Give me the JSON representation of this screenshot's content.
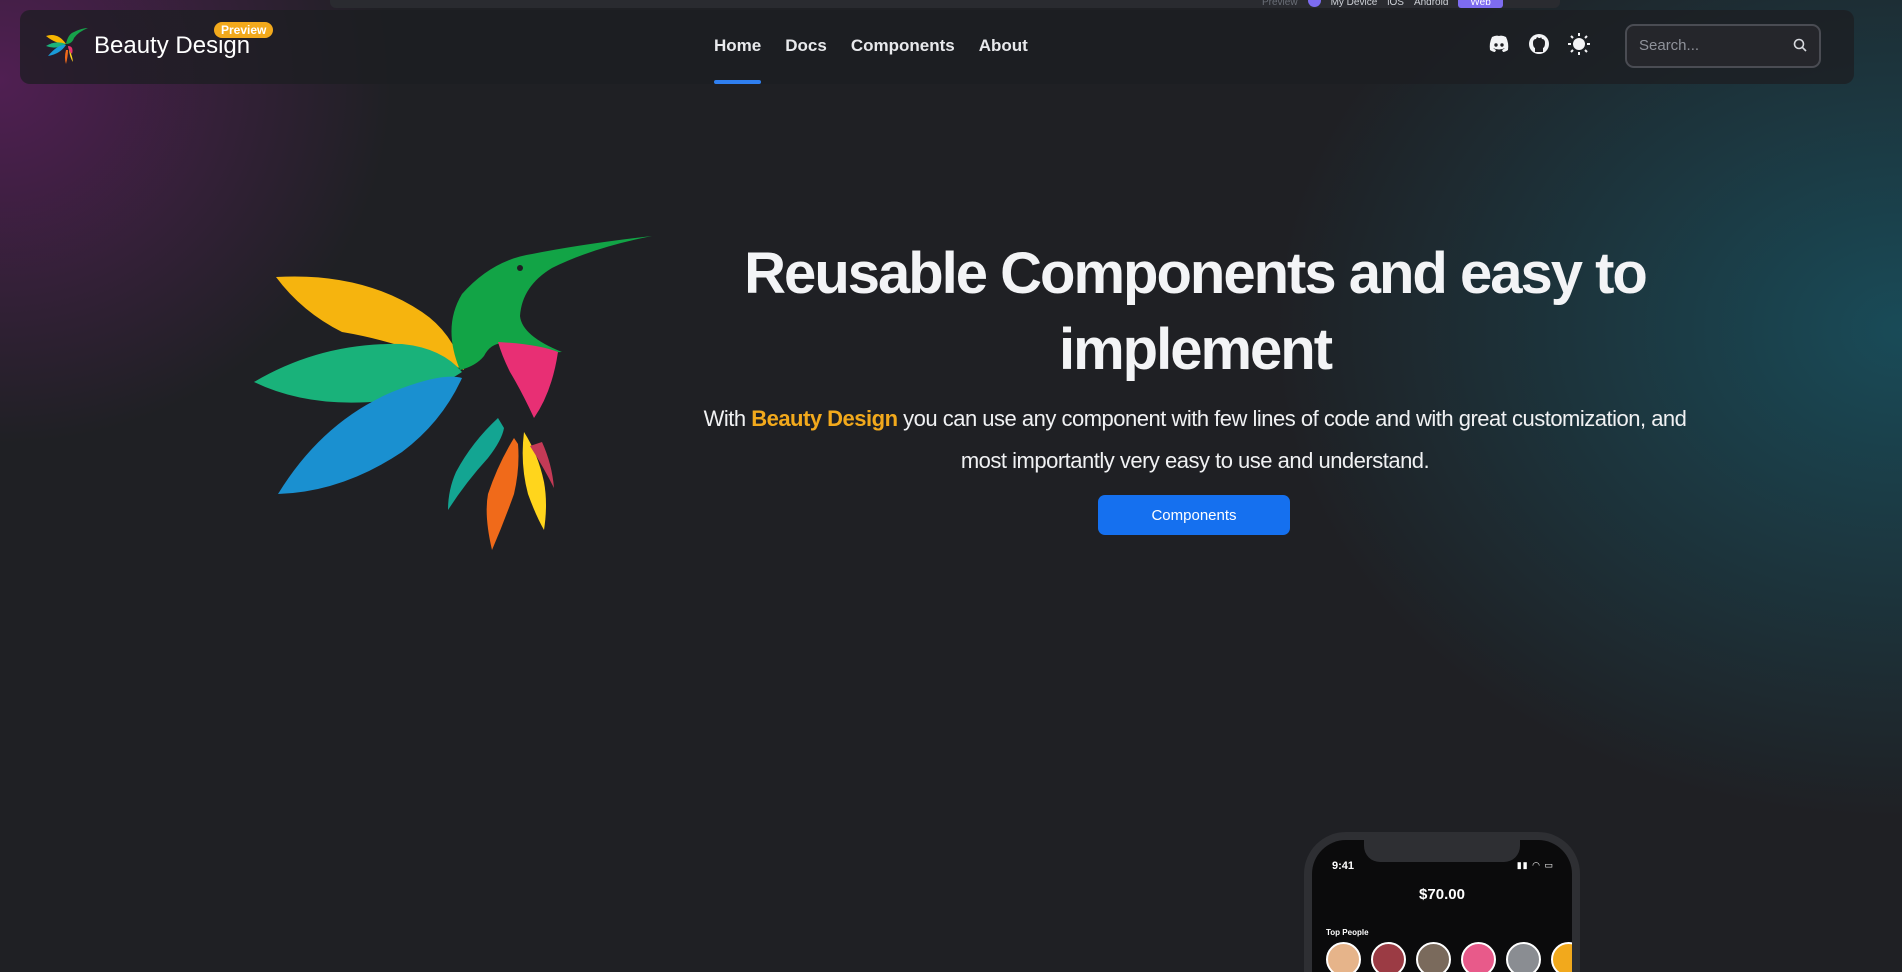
{
  "device_bar": {
    "preview_label": "Preview",
    "options": [
      "My Device",
      "iOS",
      "Android",
      "Web"
    ],
    "selected": "Web"
  },
  "header": {
    "brand": "Beauty Design",
    "badge": "Preview",
    "nav": [
      {
        "label": "Home",
        "active": true
      },
      {
        "label": "Docs",
        "active": false
      },
      {
        "label": "Components",
        "active": false
      },
      {
        "label": "About",
        "active": false
      }
    ],
    "icons": [
      "discord-icon",
      "github-icon",
      "theme-toggle-icon"
    ],
    "search_placeholder": "Search..."
  },
  "hero": {
    "title": "Reusable Components and easy to implement",
    "subtitle_prefix": "With ",
    "subtitle_brand": "Beauty Design",
    "subtitle_rest": " you can use any component with few lines of code and with great customization, and most importantly very easy to use and understand.",
    "cta": "Components"
  },
  "phone": {
    "time": "9:41",
    "amount": "$70.00",
    "section": "Top People"
  },
  "colors": {
    "accent": "#1570ef",
    "brand": "#f2a91c",
    "nav_indicator": "#2f7ff0",
    "device_selected": "#7d6cf0"
  }
}
